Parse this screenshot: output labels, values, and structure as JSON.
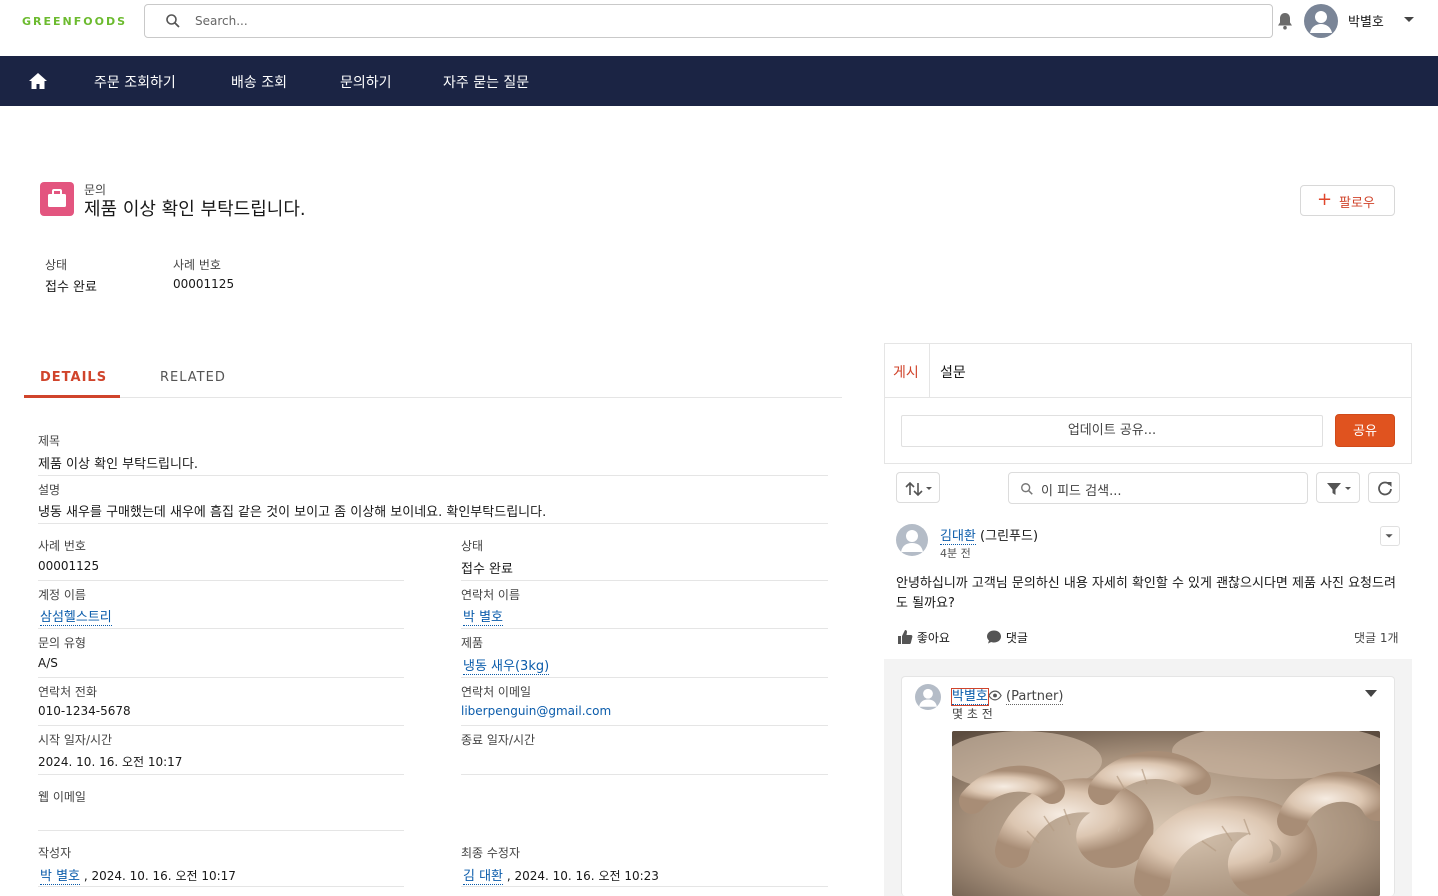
{
  "header": {
    "logo": "GREENFOODS",
    "search_placeholder": "Search...",
    "user_name": "박별호"
  },
  "nav": {
    "items": [
      "주문 조회하기",
      "배송 조회",
      "문의하기",
      "자주 묻는 질문"
    ]
  },
  "record": {
    "type_label": "문의",
    "title": "제품 이상 확인 부탁드립니다.",
    "follow_label": "팔로우",
    "highlights": [
      {
        "label": "상태",
        "value": "접수 완료"
      },
      {
        "label": "사례 번호",
        "value": "00001125"
      }
    ]
  },
  "tabs": {
    "details": "DETAILS",
    "related": "RELATED"
  },
  "details": {
    "subject_label": "제목",
    "subject_value": "제품 이상 확인 부탁드립니다.",
    "description_label": "설명",
    "description_value": "냉동 새우를 구매했는데 새우에 흠집 같은 것이 보이고 좀 이상해 보이네요. 확인부탁드립니다.",
    "case_number_label": "사례 번호",
    "case_number_value": "00001125",
    "status_label": "상태",
    "status_value": "접수 완료",
    "account_label": "계정 이름",
    "account_value": "삼섬헬스트리",
    "contact_label": "연락처 이름",
    "contact_value": "박 별호",
    "type_label": "문의 유형",
    "type_value": "A/S",
    "product_label": "제품",
    "product_value": "냉동 새우(3kg)",
    "phone_label": "연락처 전화",
    "phone_value": "010-1234-5678",
    "email_label": "연락처 이메일",
    "email_value": "liberpenguin@gmail.com",
    "start_label": "시작 일자/시간",
    "start_value": "2024. 10. 16. 오전 10:17",
    "end_label": "종료 일자/시간",
    "web_email_label": "웹 이메일",
    "created_label": "작성자",
    "created_by": "박 별호",
    "created_at": ", 2024. 10. 16. 오전 10:17",
    "modified_label": "최종 수정자",
    "modified_by": "김 대환",
    "modified_at": ", 2024. 10. 16. 오전 10:23"
  },
  "feed": {
    "tab_post": "게시",
    "tab_poll": "설문",
    "share_placeholder": "업데이트 공유...",
    "share_button": "공유",
    "search_placeholder": "이 피드 검색...",
    "post": {
      "author": "김대환",
      "org": "(그린푸드)",
      "time": "4분 전",
      "body": "안녕하십니까 고객님 문의하신 내용 자세히 확인할 수 있게 괜찮으시다면 제품 사진 요청드려도 될까요?",
      "like_label": "좋아요",
      "comment_label": "댓글",
      "comment_count": "댓글 1개"
    },
    "comment": {
      "author": "박별호",
      "role": "(Partner)",
      "time": "몇 초 전"
    }
  }
}
